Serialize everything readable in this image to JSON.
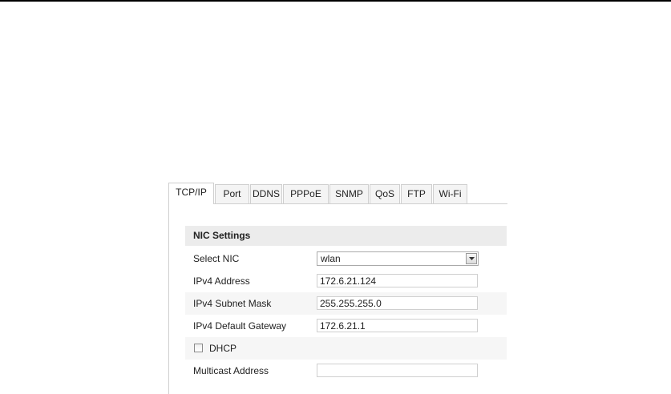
{
  "tabs": [
    "TCP/IP",
    "Port",
    "DDNS",
    "PPPoE",
    "SNMP",
    "QoS",
    "FTP",
    "Wi-Fi"
  ],
  "active_tab": "TCP/IP",
  "section": {
    "title": "NIC Settings"
  },
  "fields": {
    "select_nic": {
      "label": "Select NIC",
      "value": "wlan"
    },
    "ipv4_address": {
      "label": "IPv4 Address",
      "value": "172.6.21.124"
    },
    "ipv4_subnet_mask": {
      "label": "IPv4 Subnet Mask",
      "value": "255.255.255.0"
    },
    "ipv4_default_gateway": {
      "label": "IPv4 Default Gateway",
      "value": "172.6.21.1"
    },
    "dhcp": {
      "label": "DHCP",
      "checked": false
    },
    "multicast_address": {
      "label": "Multicast Address",
      "value": ""
    }
  }
}
